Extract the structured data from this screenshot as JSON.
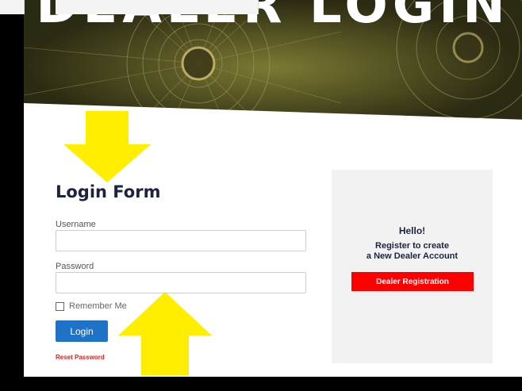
{
  "hero": {
    "title": "DEALER LOGIN"
  },
  "login_form": {
    "title": "Login Form",
    "username_label": "Username",
    "username_value": "",
    "password_label": "Password",
    "password_value": "",
    "remember_label": "Remember Me",
    "remember_checked": false,
    "login_button": "Login",
    "reset_link": "Reset Password"
  },
  "registration": {
    "hello": "Hello!",
    "line1": "Register to create",
    "line2": "a New Dealer Account",
    "button": "Dealer Registration"
  },
  "colors": {
    "login_button": "#1e73c8",
    "registration_button": "#ff0000",
    "reset_link": "#dd2222",
    "arrow": "#ffee00"
  }
}
